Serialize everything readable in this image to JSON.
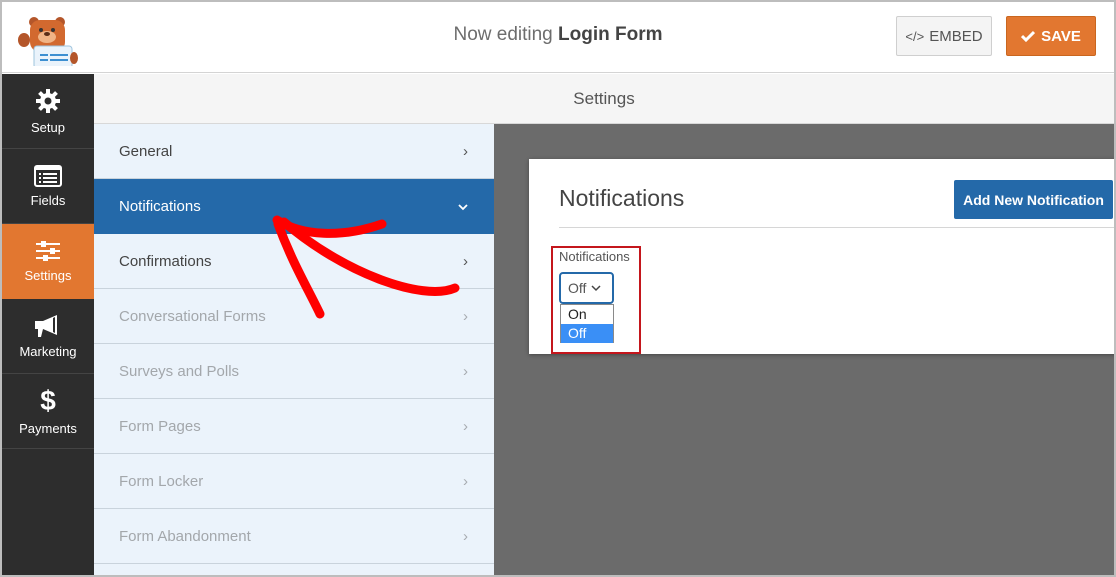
{
  "header": {
    "title_prefix": "Now editing",
    "form_name": "Login Form",
    "embed_label": "EMBED",
    "save_label": "SAVE"
  },
  "leftnav": {
    "items": [
      {
        "label": "Setup",
        "icon": "gear-icon",
        "active": false
      },
      {
        "label": "Fields",
        "icon": "list-icon",
        "active": false
      },
      {
        "label": "Settings",
        "icon": "sliders-icon",
        "active": true
      },
      {
        "label": "Marketing",
        "icon": "megaphone-icon",
        "active": false
      },
      {
        "label": "Payments",
        "icon": "dollar-icon",
        "active": false
      }
    ]
  },
  "settings_header": {
    "title": "Settings"
  },
  "submenu": {
    "items": [
      {
        "label": "General",
        "state": "normal"
      },
      {
        "label": "Notifications",
        "state": "active"
      },
      {
        "label": "Confirmations",
        "state": "normal"
      },
      {
        "label": "Conversational Forms",
        "state": "disabled"
      },
      {
        "label": "Surveys and Polls",
        "state": "disabled"
      },
      {
        "label": "Form Pages",
        "state": "disabled"
      },
      {
        "label": "Form Locker",
        "state": "disabled"
      },
      {
        "label": "Form Abandonment",
        "state": "disabled"
      }
    ]
  },
  "panel": {
    "title": "Notifications",
    "add_button_label": "Add New Notification",
    "field_label": "Notifications",
    "select_value": "Off",
    "options": [
      {
        "label": "On",
        "selected": false
      },
      {
        "label": "Off",
        "selected": true
      }
    ]
  },
  "colors": {
    "accent_orange": "#e27730",
    "accent_blue": "#2469a9",
    "annotation_red": "#ff0000",
    "highlight_red": "#c4161c"
  }
}
